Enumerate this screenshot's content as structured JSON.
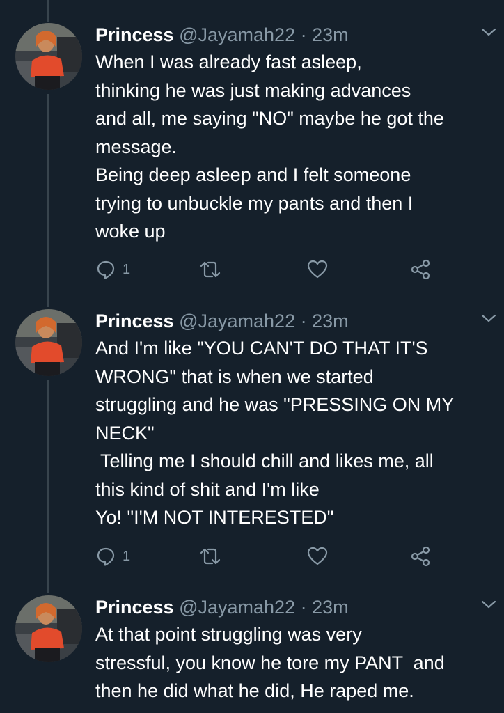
{
  "colors": {
    "background": "#15202b",
    "text": "#ffffff",
    "secondary": "#8899a6",
    "thread_line": "#38444d"
  },
  "tweets": [
    {
      "name": "Princess",
      "handle": "@Jayamah22",
      "separator": "·",
      "time": "23m",
      "lines": [
        "When I was already fast asleep,",
        "thinking he was just making advances",
        "and all, me saying \"NO\" maybe he got the",
        "message.",
        "Being deep asleep and I felt someone",
        "trying to unbuckle my pants and then I",
        "woke up"
      ],
      "reply_count": "1"
    },
    {
      "name": "Princess",
      "handle": "@Jayamah22",
      "separator": "·",
      "time": "23m",
      "lines": [
        "And I'm like \"YOU CAN'T DO THAT IT'S",
        "WRONG\" that is when we started",
        "struggling and he was \"PRESSING ON MY",
        "NECK\"",
        " Telling me I should chill and likes me, all",
        "this kind of shit and I'm like",
        "Yo! \"I'M NOT INTERESTED\""
      ],
      "reply_count": "1"
    },
    {
      "name": "Princess",
      "handle": "@Jayamah22",
      "separator": "·",
      "time": "23m",
      "lines": [
        "At that point struggling was very",
        "stressful, you know he tore my PANT  and",
        "then he did what he did, He raped me."
      ]
    }
  ],
  "icons": {
    "reply": "reply-icon",
    "retweet": "retweet-icon",
    "like": "heart-icon",
    "share": "share-icon",
    "more": "chevron-down-icon"
  }
}
